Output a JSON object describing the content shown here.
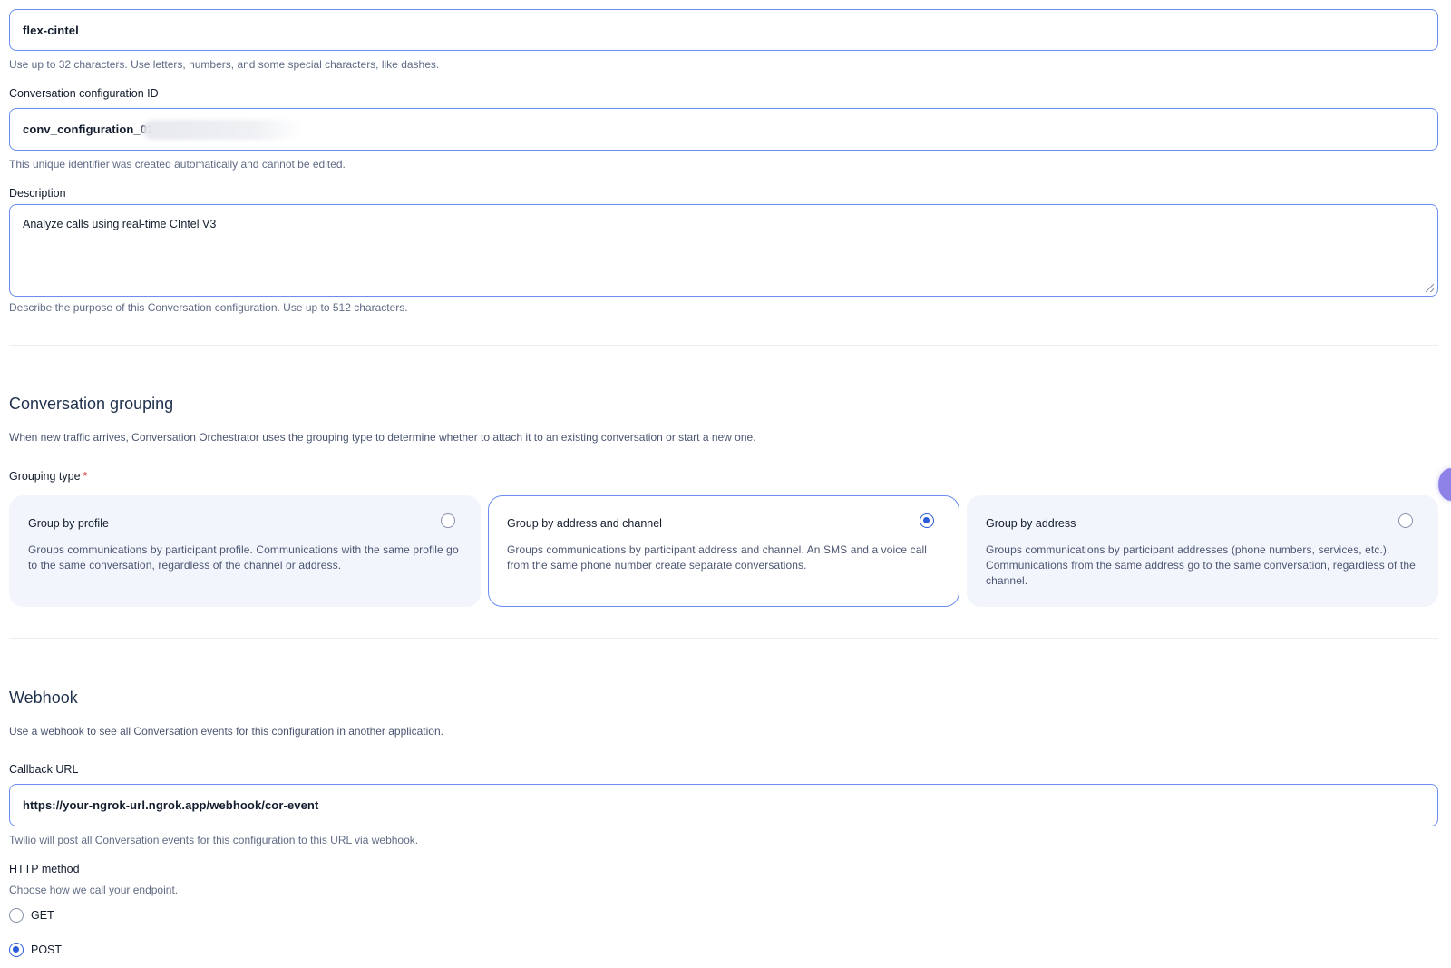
{
  "name_field": {
    "value": "flex-cintel",
    "help": "Use up to 32 characters. Use letters, numbers, and some special characters, like dashes."
  },
  "config_id_field": {
    "label": "Conversation configuration ID",
    "value": "conv_configuration_01",
    "help": "This unique identifier was created automatically and cannot be edited."
  },
  "description_field": {
    "label": "Description",
    "value": "Analyze calls using real-time CIntel V3",
    "help": "Describe the purpose of this Conversation configuration. Use up to 512 characters."
  },
  "grouping": {
    "title": "Conversation grouping",
    "description": "When new traffic arrives, Conversation Orchestrator uses the grouping type to determine whether to attach it to an existing conversation or start a new one.",
    "type_label": "Grouping type",
    "required_mark": "*",
    "options": [
      {
        "title": "Group by profile",
        "description": "Groups communications by participant profile. Communications with the same profile go to the same conversation, regardless of the channel or address.",
        "selected": false
      },
      {
        "title": "Group by address and channel",
        "description": "Groups communications by participant address and channel. An SMS and a voice call from the same phone number create separate conversations.",
        "selected": true
      },
      {
        "title": "Group by address",
        "description": "Groups communications by participant addresses (phone numbers, services, etc.). Communications from the same address go to the same conversation, regardless of the channel.",
        "selected": false
      }
    ]
  },
  "webhook": {
    "title": "Webhook",
    "description": "Use a webhook to see all Conversation events for this configuration in another application.",
    "callback_label": "Callback URL",
    "callback_value": "https://your-ngrok-url.ngrok.app/webhook/cor-event",
    "callback_help": "Twilio will post all Conversation events for this configuration to this URL via webhook.",
    "method_label": "HTTP method",
    "method_help": "Choose how we call your endpoint.",
    "methods": [
      {
        "label": "GET",
        "selected": false
      },
      {
        "label": "POST",
        "selected": true
      }
    ]
  },
  "colors": {
    "accent": "#2c5dd8",
    "focus_border": "#6b8ef0",
    "card_bg": "#f3f5fd",
    "help_text": "#606b85"
  }
}
